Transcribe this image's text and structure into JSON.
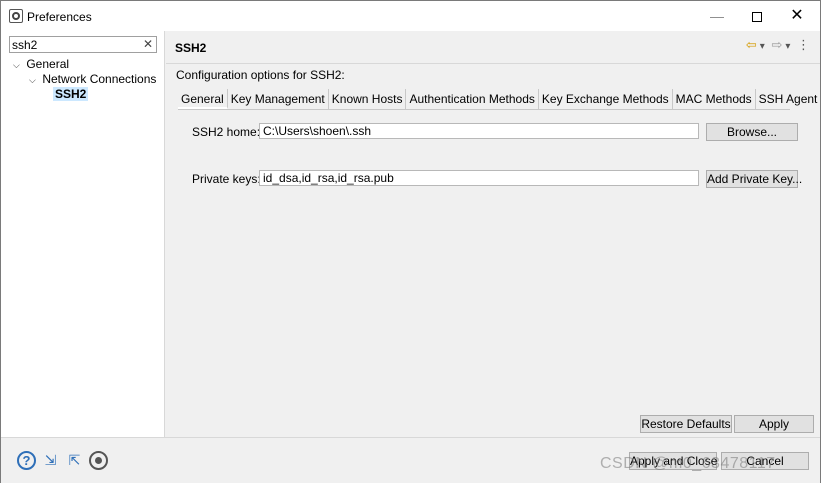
{
  "window": {
    "title": "Preferences",
    "minimize_glyph": "—",
    "close_glyph": "✕"
  },
  "sidebar": {
    "filter_value": "ssh2",
    "filter_clear_glyph": "✕",
    "tree": [
      {
        "label": "General",
        "expanded": true
      },
      {
        "label": "Network Connections",
        "expanded": true
      },
      {
        "label": "SSH2",
        "selected": true
      }
    ]
  },
  "header": {
    "page_title": "SSH2",
    "back_glyph": "⇦",
    "forward_glyph": "⇨",
    "dropdown_glyph": "▾",
    "menu_glyph": "⋮"
  },
  "main": {
    "description": "Configuration options for SSH2:",
    "tabs": [
      {
        "label": "General",
        "active": true
      },
      {
        "label": "Key Management"
      },
      {
        "label": "Known Hosts"
      },
      {
        "label": "Authentication Methods"
      },
      {
        "label": "Key Exchange Methods"
      },
      {
        "label": "MAC Methods"
      },
      {
        "label": "SSH Agent"
      }
    ],
    "ssh2_home_label": "SSH2 home:",
    "ssh2_home_value": "C:\\Users\\shoen\\.ssh",
    "browse_label": "Browse...",
    "private_keys_label": "Private keys:",
    "private_keys_value": "id_dsa,id_rsa,id_rsa.pub",
    "add_private_key_label": "Add Private Key...",
    "restore_defaults_label": "Restore Defaults",
    "apply_label": "Apply"
  },
  "footer": {
    "help_glyph": "?",
    "import_glyph": "⇲",
    "export_glyph": "⇱",
    "apply_and_close_label": "Apply and Close",
    "cancel_label": "Cancel"
  },
  "watermark": "CSDN @m0_63478117",
  "colors": {
    "selection": "#cce8ff",
    "icon_blue": "#2e6fb8",
    "back_arrow": "#d49a00"
  }
}
